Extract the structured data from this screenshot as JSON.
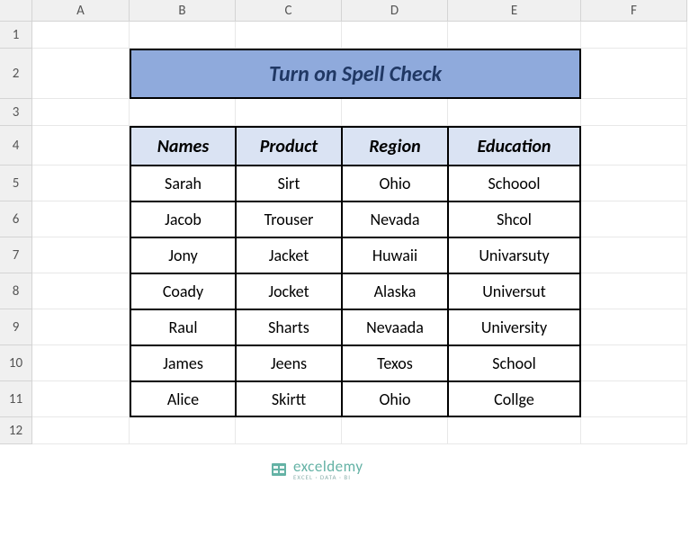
{
  "columns": [
    "A",
    "B",
    "C",
    "D",
    "E",
    "F"
  ],
  "row_numbers": [
    "1",
    "2",
    "3",
    "4",
    "5",
    "6",
    "7",
    "8",
    "9",
    "10",
    "11",
    "12"
  ],
  "title": "Turn on Spell Check",
  "headers": [
    "Names",
    "Product",
    "Region",
    "Education"
  ],
  "rows": [
    [
      "Sarah",
      "Sirt",
      "Ohio",
      "Schoool"
    ],
    [
      "Jacob",
      "Trouser",
      "Nevada",
      "Shcol"
    ],
    [
      "Jony",
      "Jacket",
      "Huwaii",
      "Univarsuty"
    ],
    [
      "Coady",
      "Jocket",
      "Alaska",
      "Universut"
    ],
    [
      "Raul",
      "Sharts",
      "Nevaada",
      "University"
    ],
    [
      "James",
      "Jeens",
      "Texos",
      "School"
    ],
    [
      "Alice",
      "Skirtt",
      "Ohio",
      "Collge"
    ]
  ],
  "watermark": {
    "main": "exceldemy",
    "sub": "EXCEL · DATA · BI"
  }
}
